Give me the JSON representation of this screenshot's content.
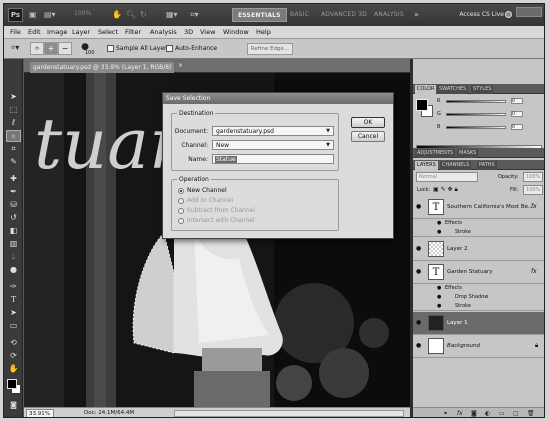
{
  "appbar": {
    "logo": "Ps",
    "zoom": "100%",
    "workspaces": [
      "ESSENTIALS",
      "BASIC",
      "ADVANCED 3D",
      "ANALYSIS"
    ],
    "more": "»",
    "cs_live": "Access CS Live"
  },
  "menu": [
    "File",
    "Edit",
    "Image",
    "Layer",
    "Select",
    "Filter",
    "Analysis",
    "3D",
    "View",
    "Window",
    "Help"
  ],
  "options": {
    "brush_size": "100",
    "sample_all_layers": "Sample All Layers",
    "auto_enhance": "Auto-Enhance",
    "refine_edge": "Refine Edge..."
  },
  "document": {
    "tab_title": "gardenstatuary.psd @ 33.9% (Layer 1, RGB/8)",
    "tab_close": "×",
    "canvas_text": "tuary",
    "zoom": "33.91%",
    "doc_size": "Doc: 24.1M/64.4M"
  },
  "dialog": {
    "title": "Save Selection",
    "destination_label": "Destination",
    "document_label": "Document:",
    "document_value": "gardenstatuary.psd",
    "channel_label": "Channel:",
    "channel_value": "New",
    "name_label": "Name:",
    "name_value": "Statue",
    "operation_label": "Operation",
    "operations": [
      "New Channel",
      "Add to Channel",
      "Subtract from Channel",
      "Intersect with Channel"
    ],
    "ok": "OK",
    "cancel": "Cancel"
  },
  "panels": {
    "color_tabs": [
      "COLOR",
      "SWATCHES",
      "STYLES"
    ],
    "adjust_tabs": [
      "ADJUSTMENTS",
      "MASKS"
    ],
    "layer_tabs": [
      "LAYERS",
      "CHANNELS",
      "PATHS"
    ],
    "sliders": [
      {
        "letter": "R",
        "value": "0"
      },
      {
        "letter": "G",
        "value": "0"
      },
      {
        "letter": "B",
        "value": "0"
      }
    ],
    "blend_mode": "Normal",
    "opacity_label": "Opacity:",
    "opacity": "100%",
    "lock_label": "Lock:",
    "fill_label": "Fill:",
    "fill": "100%"
  },
  "layers": {
    "layer1": {
      "name": "Southern California's Most Be...",
      "fx": "fx"
    },
    "layer1_effects": "Effects",
    "layer1_stroke": "Stroke",
    "layer2": {
      "name": "Layer 2"
    },
    "layer3": {
      "name": "Garden Statuary",
      "fx": "fx"
    },
    "layer3_effects": "Effects",
    "layer3_shadow": "Drop Shadow",
    "layer3_stroke": "Stroke",
    "layer4": {
      "name": "Layer 1"
    },
    "layer5": {
      "name": "Background"
    }
  },
  "colors": {
    "chrome_dark": "#343434",
    "panel_gray": "#c6c6c6",
    "selected_layer": "#6a6a6a"
  }
}
